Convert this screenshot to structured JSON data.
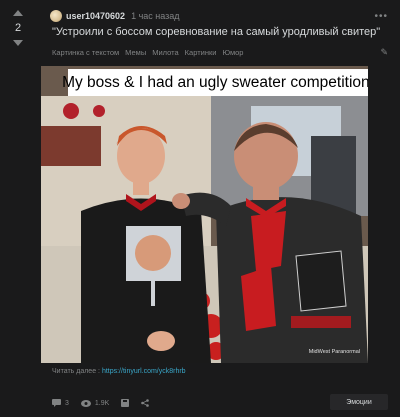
{
  "vote": {
    "score": "2"
  },
  "post": {
    "username": "user10470602",
    "timestamp": "1 час назад",
    "title": "\"Устроили с боссом соревнование на самый уродливый свитер\"",
    "tags": [
      "Картинка с текстом",
      "Мемы",
      "Милота",
      "Картинки",
      "Юмор"
    ],
    "image_caption": "My boss & I had an ugly sweater competition.",
    "watermark": "MidWest Paranormal",
    "read_more_label": "Читать далее : ",
    "read_more_link": "https://tinyurl.com/yck8rhrb"
  },
  "footer": {
    "comments": "3",
    "views": "1.9K",
    "emotions_label": "Эмоции"
  }
}
